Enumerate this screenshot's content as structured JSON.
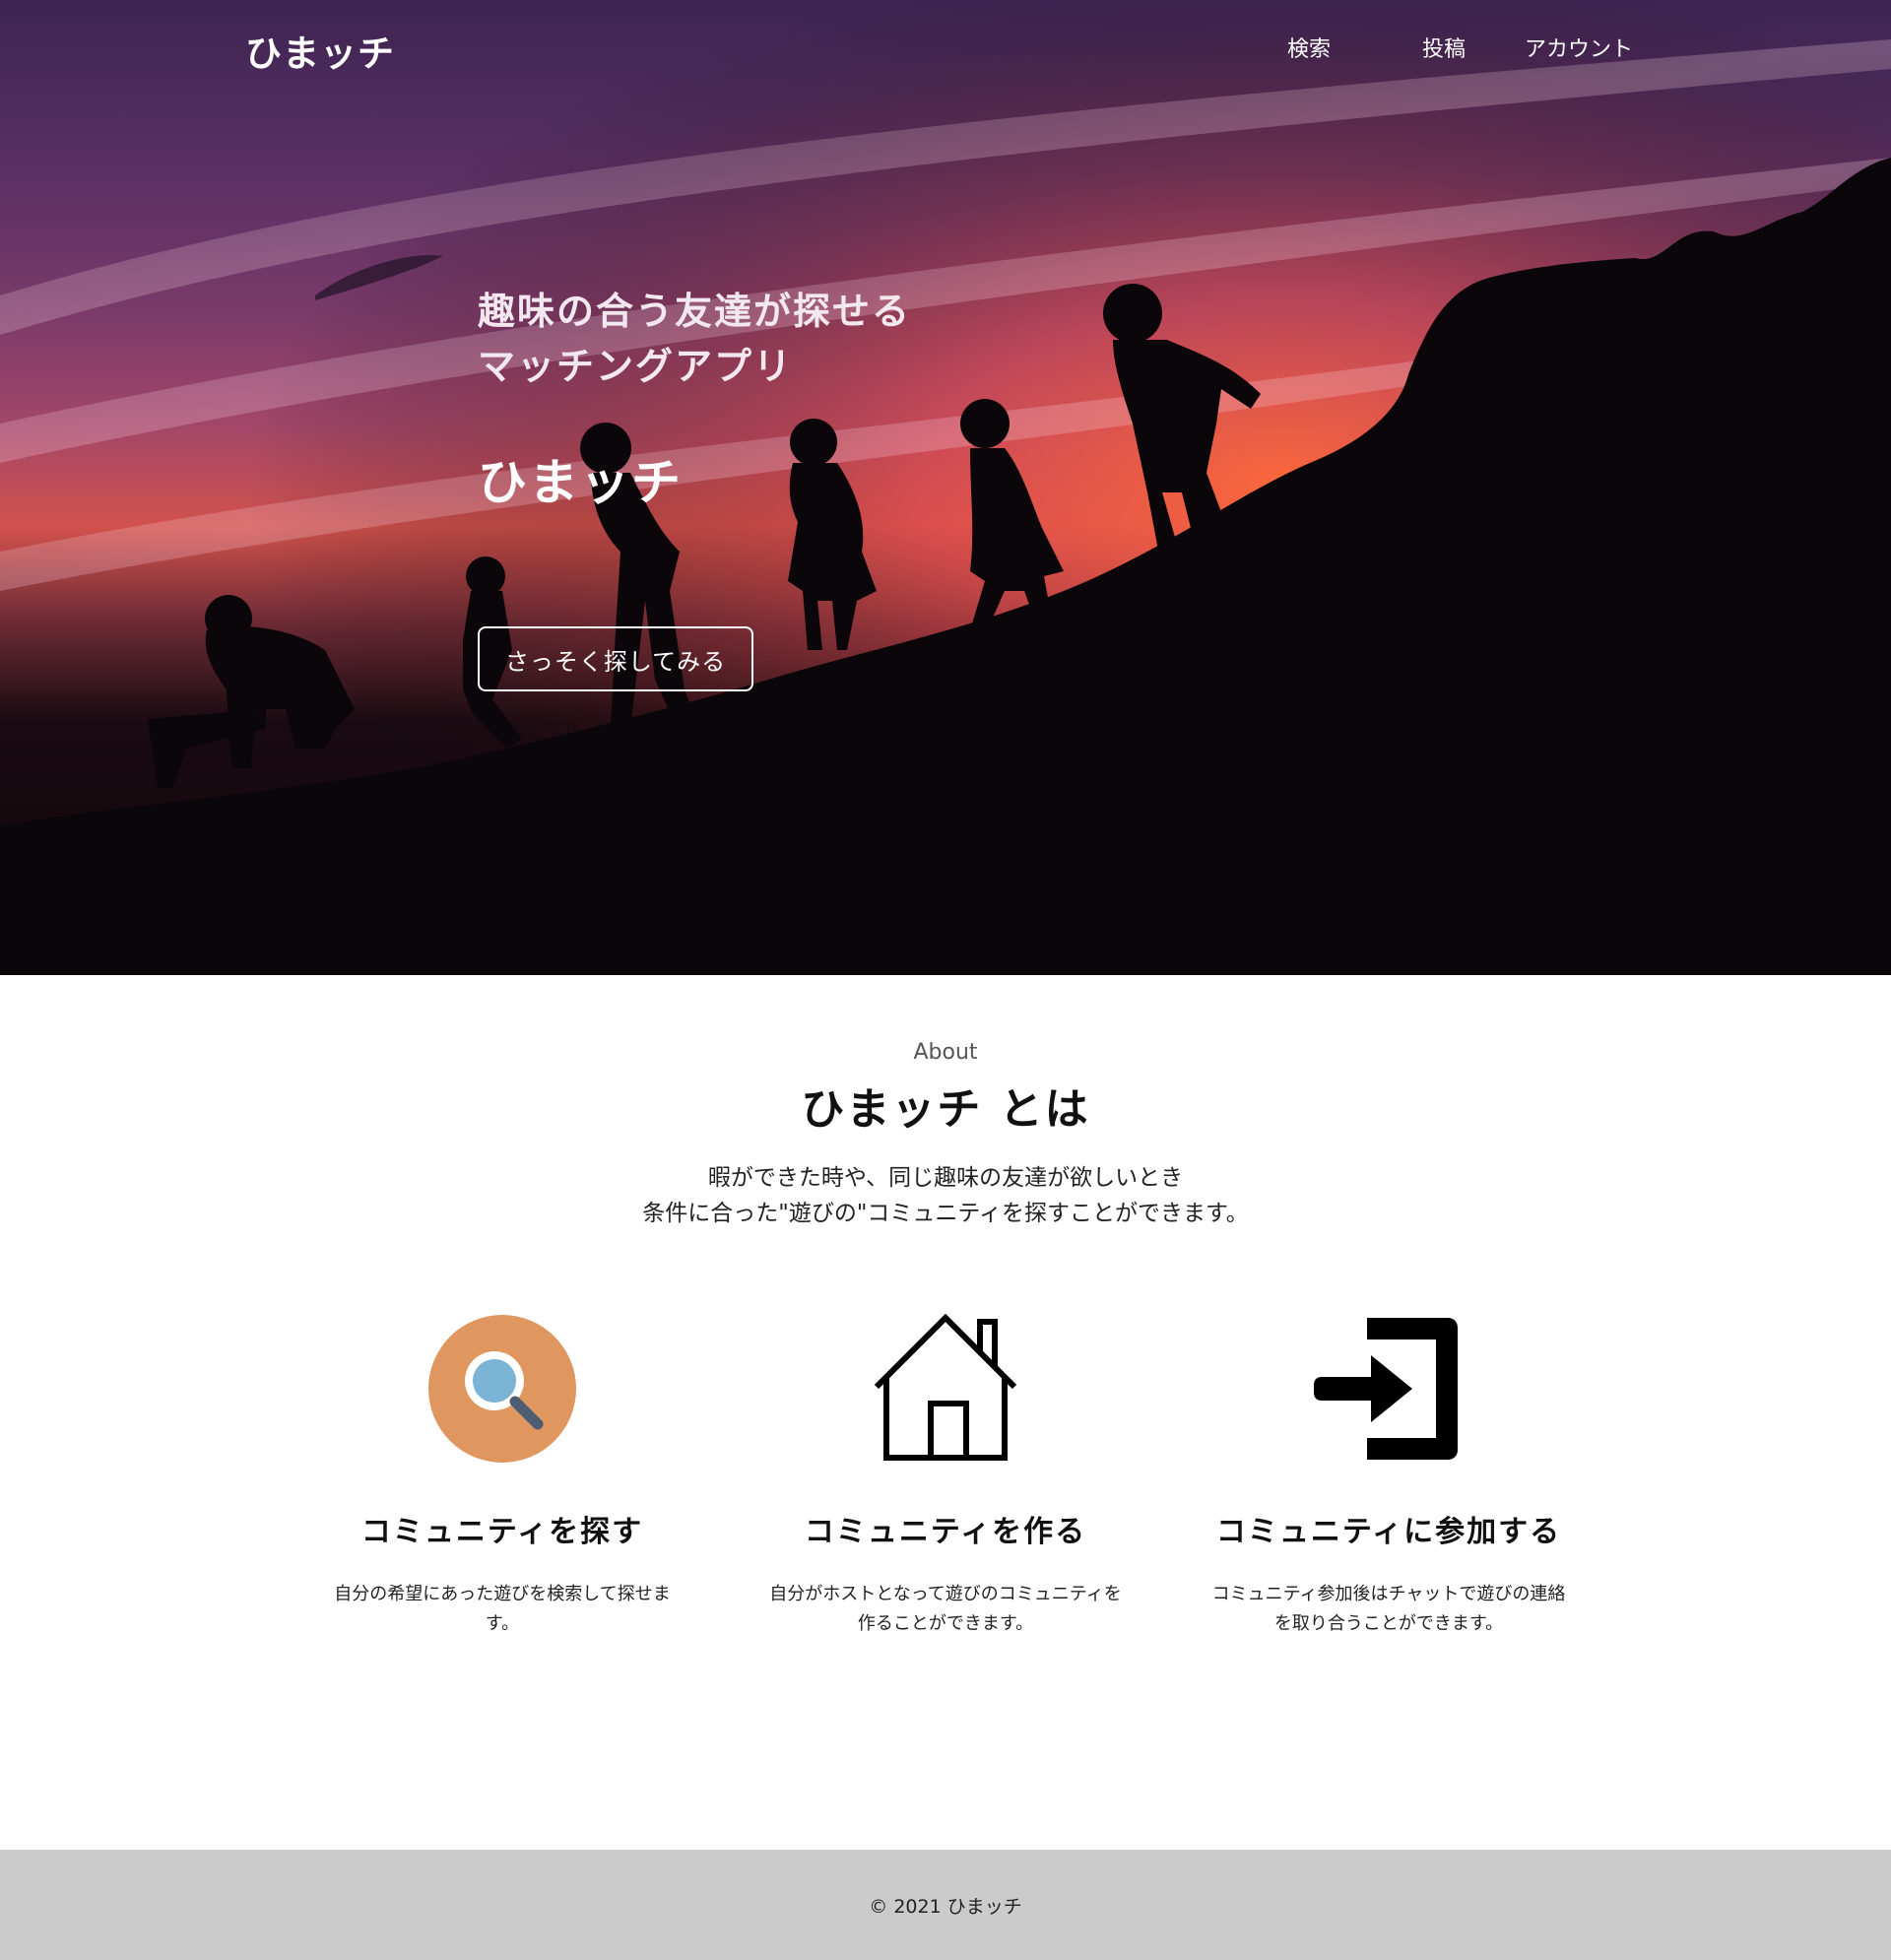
{
  "header": {
    "logo": "ひまッチ",
    "nav": [
      "検索",
      "投稿",
      "アカウント"
    ]
  },
  "hero": {
    "tagline_line1": "趣味の合う友達が探せる",
    "tagline_line2": "マッチングアプリ",
    "title": "ひまッチ",
    "cta_label": "さっそく探してみる"
  },
  "about": {
    "eyebrow": "About",
    "title": "ひまッチ とは",
    "desc_line1": "暇ができた時や、同じ趣味の友達が欲しいとき",
    "desc_line2": "条件に合った\"遊びの\"コミュニティを探すことができます。"
  },
  "features": [
    {
      "icon": "search-icon",
      "title": "コミュニティを探す",
      "text": "自分の希望にあった遊びを検索して探せます。"
    },
    {
      "icon": "house-icon",
      "title": "コミュニティを作る",
      "text": "自分がホストとなって遊びのコミュニティを作ることができます。"
    },
    {
      "icon": "sign-in-icon",
      "title": "コミュニティに参加する",
      "text": "コミュニティ参加後はチャットで遊びの連絡を取り合うことができます。"
    }
  ],
  "footer": {
    "copyright": "© 2021 ひまッチ"
  },
  "colors": {
    "search_icon_bg": "#e0975f",
    "search_icon_lens": "#7ab3d4",
    "footer_bg": "#cbcbcb"
  }
}
